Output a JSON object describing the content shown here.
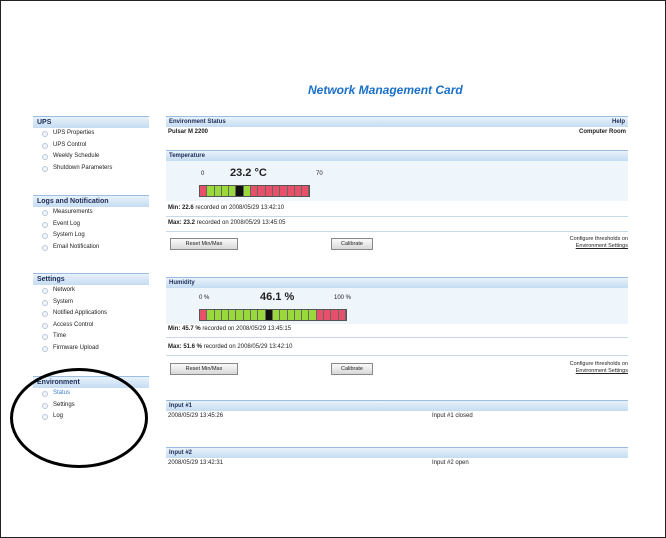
{
  "card_title": "Network Management Card",
  "sidebar": {
    "ups": {
      "title": "UPS",
      "items": [
        "UPS Properties",
        "UPS Control",
        "Weekly Schedule",
        "Shutdown Parameters"
      ]
    },
    "logs": {
      "title": "Logs and Notification",
      "items": [
        "Measurements",
        "Event Log",
        "System Log",
        "Email Notification"
      ]
    },
    "settings": {
      "title": "Settings",
      "items": [
        "Network",
        "System",
        "Notified Applications",
        "Access Control",
        "Time",
        "Firmware Upload"
      ]
    },
    "environment": {
      "title": "Environment",
      "items": [
        "Status",
        "Settings",
        "Log"
      ],
      "active": "Status"
    }
  },
  "env_status": {
    "title": "Environment Status",
    "help": "Help",
    "device": "Pulsar M 2200",
    "location": "Computer Room"
  },
  "temperature": {
    "title": "Temperature",
    "scale_min": "0",
    "scale_max": "70",
    "value": "23.2 °C",
    "level": 0.33,
    "min_line_value": "Min: 22.6",
    "min_line_text": "recorded on 2008/05/29 13:42:10",
    "max_line_value": "Max: 23.2",
    "max_line_text": "recorded on 2008/05/29 13:45:05",
    "reset_label": "Reset Min/Max",
    "calibrate_label": "Calibrate",
    "configure_text": "Configure thresholds on",
    "configure_link": "Environment Settings"
  },
  "humidity": {
    "title": "Humidity",
    "scale_min": "0 %",
    "scale_max": "100 %",
    "value": "46.1 %",
    "level": 0.461,
    "min_line_value": "Min: 45.7 %",
    "min_line_text": "recorded on 2008/05/29 13:45:15",
    "max_line_value": "Max: 51.6 %",
    "max_line_text": "recorded on 2008/05/29 13:42:10",
    "reset_label": "Reset Min/Max",
    "calibrate_label": "Calibrate",
    "configure_text": "Configure thresholds on",
    "configure_link": "Environment Settings"
  },
  "input1": {
    "title": "Input #1",
    "timestamp": "2008/05/29 13:45:26",
    "status": "Input #1 closed"
  },
  "input2": {
    "title": "Input #2",
    "timestamp": "2008/05/29 13:42:31",
    "status": "Input #2 open"
  },
  "colors": {
    "green": "#9ad93a",
    "red": "#e8506a",
    "marker": "#111111",
    "header_blue": "#1a6fc9"
  }
}
